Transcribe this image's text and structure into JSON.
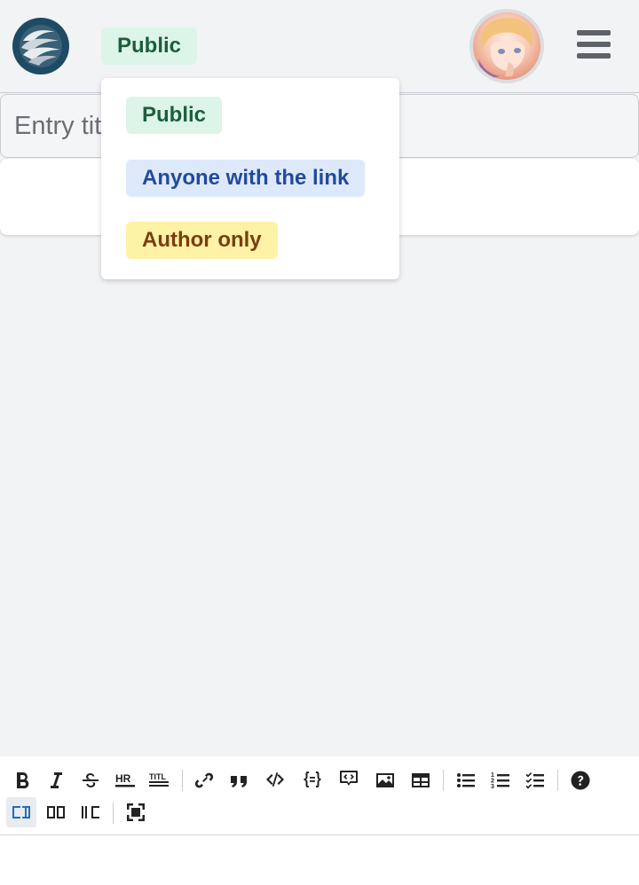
{
  "header": {
    "visibility_label": "Public"
  },
  "entry": {
    "title_placeholder": "Entry title"
  },
  "visibility_menu": {
    "options": [
      {
        "label": "Public",
        "color": "#dcf5e8",
        "text_color": "#1b5e3c"
      },
      {
        "label": "Anyone with the link",
        "color": "#dde9fb",
        "text_color": "#234a9a"
      },
      {
        "label": "Author only",
        "color": "#fdf2a6",
        "text_color": "#7a3d12"
      }
    ]
  },
  "toolbar": {
    "row1": [
      "bold-icon",
      "italic-icon",
      "strikethrough-icon",
      "horizontal-rule-icon",
      "title-icon",
      "link-icon",
      "quote-icon",
      "code-icon",
      "code-block-icon",
      "comment-icon",
      "image-icon",
      "table-icon",
      "bulleted-list-icon",
      "numbered-list-icon",
      "checklist-icon",
      "help-icon"
    ],
    "row2": [
      "editor-only-icon",
      "split-view-icon",
      "preview-only-icon",
      "fullscreen-icon"
    ],
    "active_icon": "editor-only-icon",
    "accent_color": "#1f6fb5"
  },
  "colors": {
    "background": "#f2f3f5",
    "logo": "#1e4a63",
    "icon": "#222222"
  }
}
